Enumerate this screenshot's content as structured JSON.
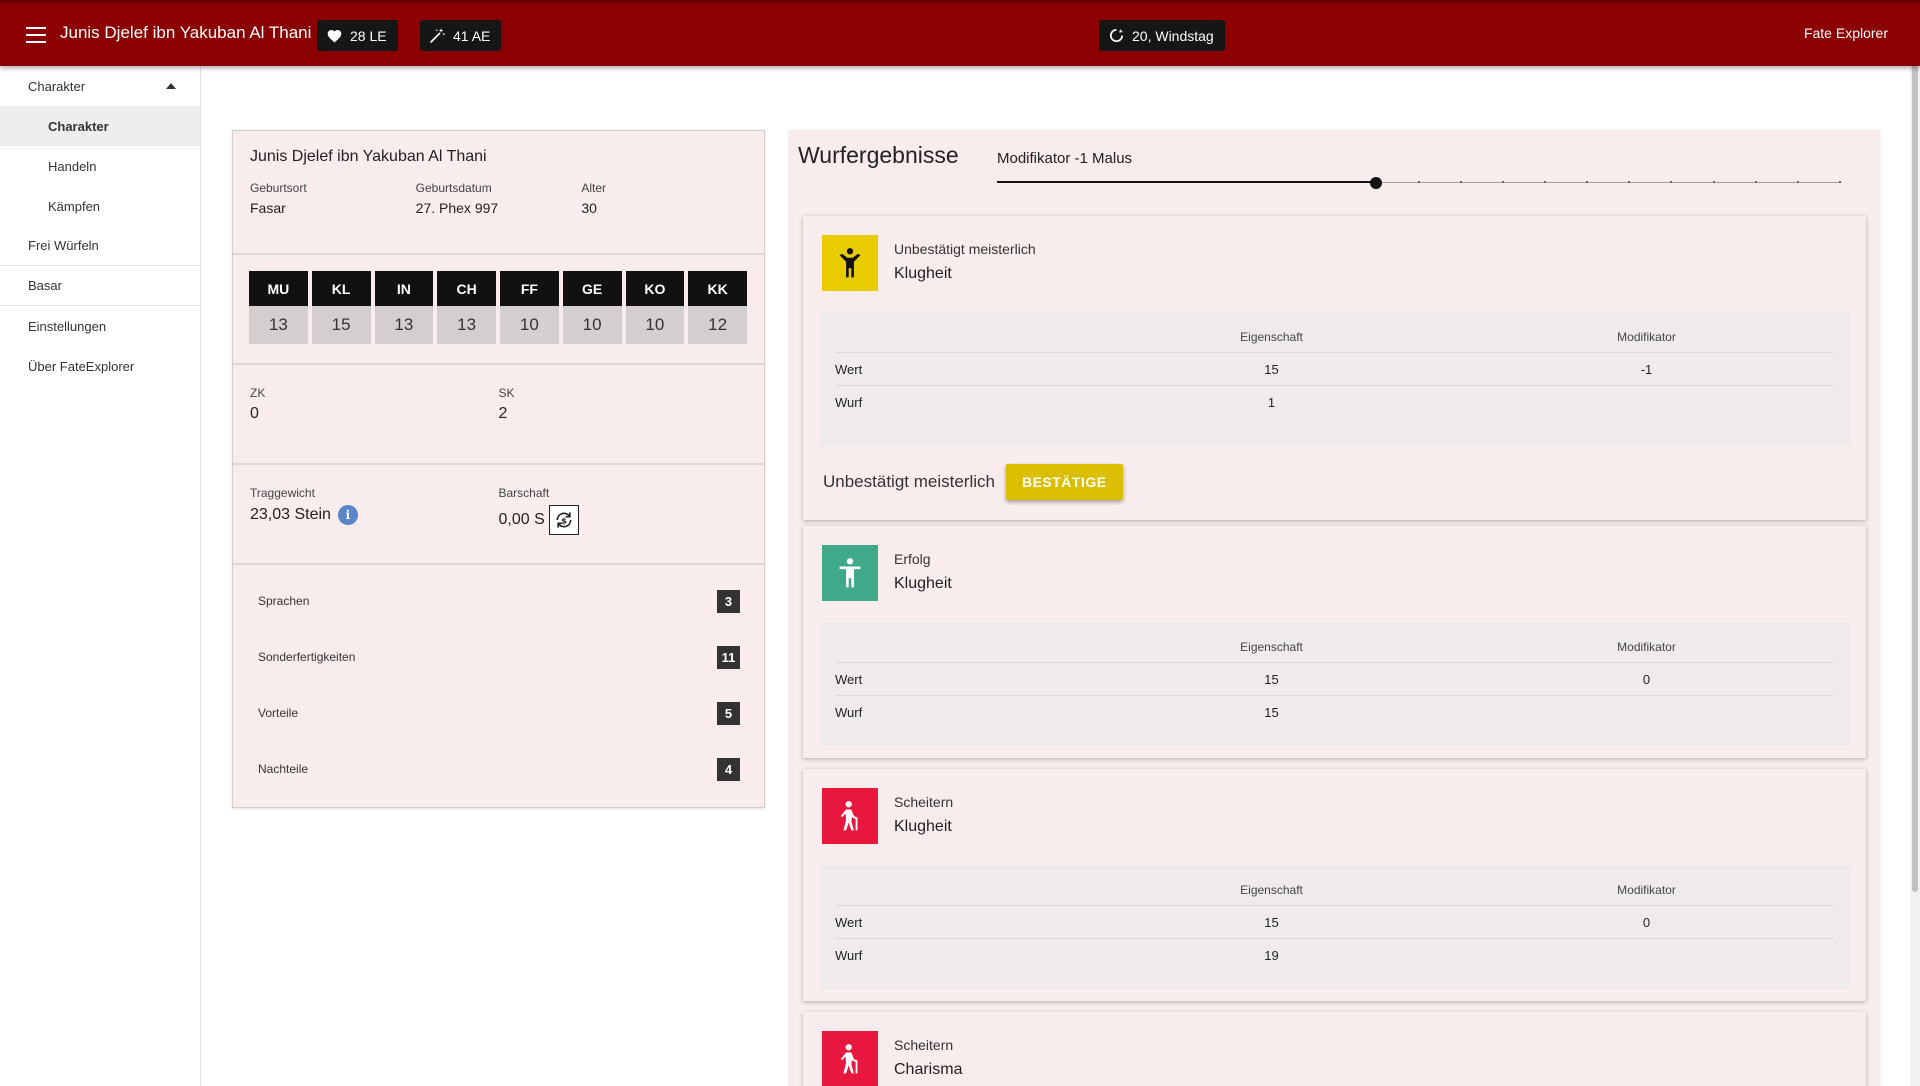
{
  "appbar": {
    "character_name": "Junis Djelef ibn Yakuban Al Thani",
    "le_label": "28 LE",
    "ae_label": "41 AE",
    "date_label": "20, Windstag",
    "brand": "Fate Explorer",
    "color": "#8b0000"
  },
  "sidebar": {
    "items": [
      {
        "label": "Charakter"
      },
      {
        "label": "Charakter"
      },
      {
        "label": "Handeln"
      },
      {
        "label": "Kämpfen"
      },
      {
        "label": "Frei Würfeln"
      },
      {
        "label": "Basar"
      },
      {
        "label": "Einstellungen"
      },
      {
        "label": "Über FateExplorer"
      }
    ]
  },
  "character": {
    "name": "Junis Djelef ibn Yakuban Al Thani",
    "birthplace_label": "Geburtsort",
    "birthplace": "Fasar",
    "birthdate_label": "Geburtsdatum",
    "birthdate": "27. Phex 997",
    "age_label": "Alter",
    "age": "30",
    "attributes": [
      {
        "abbr": "MU",
        "value": "13"
      },
      {
        "abbr": "KL",
        "value": "15"
      },
      {
        "abbr": "IN",
        "value": "13"
      },
      {
        "abbr": "CH",
        "value": "13"
      },
      {
        "abbr": "FF",
        "value": "10"
      },
      {
        "abbr": "GE",
        "value": "10"
      },
      {
        "abbr": "KO",
        "value": "10"
      },
      {
        "abbr": "KK",
        "value": "12"
      }
    ],
    "zk_label": "ZK",
    "zk": "0",
    "sk_label": "SK",
    "sk": "2",
    "weight_label": "Traggewicht",
    "weight": "23,03 Stein",
    "money_label": "Barschaft",
    "money": "0,00 S",
    "lists": [
      {
        "label": "Sprachen",
        "count": "3"
      },
      {
        "label": "Sonderfertigkeiten",
        "count": "11"
      },
      {
        "label": "Vorteile",
        "count": "5"
      },
      {
        "label": "Nachteile",
        "count": "4"
      }
    ]
  },
  "results": {
    "title": "Wurfergebnisse",
    "modifier_label": "Modifikator -1 Malus",
    "slider": {
      "min": -10,
      "max": 10,
      "value": -1
    },
    "col_attribute": "Eigenschaft",
    "col_modifier": "Modifikator",
    "row_value": "Wert",
    "row_roll": "Wurf",
    "confirm_text": "Unbestätigt meisterlich",
    "confirm_button": "BESTÄTIGE",
    "cards": [
      {
        "status": "Unbestätigt meisterlich",
        "attribute": "Klugheit",
        "value": "15",
        "modifier": "-1",
        "roll": "1",
        "color": "#e9cc00",
        "icon": "person-arms-up-icon"
      },
      {
        "status": "Erfolg",
        "attribute": "Klugheit",
        "value": "15",
        "modifier": "0",
        "roll": "15",
        "color": "#3fa98a",
        "icon": "person-standing-icon"
      },
      {
        "status": "Scheitern",
        "attribute": "Klugheit",
        "value": "15",
        "modifier": "0",
        "roll": "19",
        "color": "#e8173d",
        "icon": "person-with-cane-icon"
      },
      {
        "status": "Scheitern",
        "attribute": "Charisma",
        "color": "#e8173d",
        "icon": "person-with-cane-icon"
      }
    ]
  }
}
